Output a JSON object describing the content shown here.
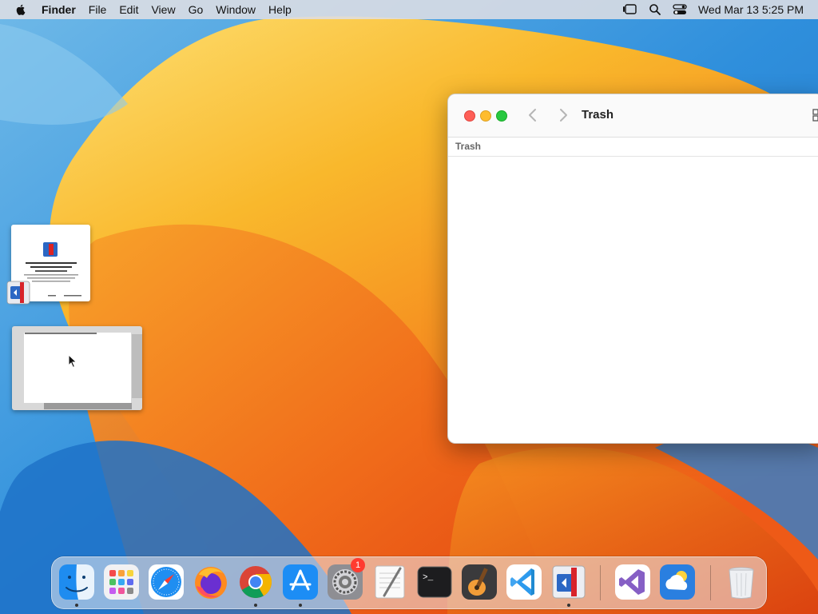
{
  "menubar": {
    "app_name": "Finder",
    "items": [
      "File",
      "Edit",
      "View",
      "Go",
      "Window",
      "Help"
    ],
    "clock": "Wed Mar 13  5:25 PM",
    "status_icons": [
      "stage-manager-icon",
      "spotlight-search-icon",
      "control-center-icon"
    ]
  },
  "finder": {
    "title": "Trash",
    "path_label": "Trash"
  },
  "dock": {
    "apps": [
      {
        "name": "Finder",
        "icon": "finder-icon",
        "running": true
      },
      {
        "name": "Launchpad",
        "icon": "launchpad-icon",
        "running": false
      },
      {
        "name": "Safari",
        "icon": "safari-icon",
        "running": false
      },
      {
        "name": "Firefox",
        "icon": "firefox-icon",
        "running": false
      },
      {
        "name": "Chrome",
        "icon": "chrome-icon",
        "running": true
      },
      {
        "name": "App Store",
        "icon": "app-store-icon",
        "running": true
      },
      {
        "name": "System Settings",
        "icon": "system-settings-icon",
        "running": false,
        "badge": "1"
      },
      {
        "name": "TextEdit",
        "icon": "textedit-icon",
        "running": false
      },
      {
        "name": "Terminal",
        "icon": "terminal-icon",
        "running": false
      },
      {
        "name": "GarageBand",
        "icon": "garageband-icon",
        "running": false
      },
      {
        "name": "VS Code",
        "icon": "vscode-icon",
        "running": false
      },
      {
        "name": "Parallels Desktop",
        "icon": "parallels-icon",
        "running": true
      },
      {
        "name": "Visual Studio",
        "icon": "visual-studio-icon",
        "running": false
      },
      {
        "name": "Weather",
        "icon": "weather-icon",
        "running": false
      },
      {
        "name": "Trash",
        "icon": "trash-icon",
        "running": false
      }
    ],
    "settings_badge": "1"
  },
  "colors": {
    "menubar_bg": "#dedee4",
    "wallpaper_orange": "#f0641a",
    "wallpaper_yellow": "#f9c32e",
    "wallpaper_blue": "#2a8bd6",
    "close": "#fe5f57",
    "minimize": "#febc2e",
    "maximize": "#28c840",
    "badge": "#ff3b30"
  }
}
